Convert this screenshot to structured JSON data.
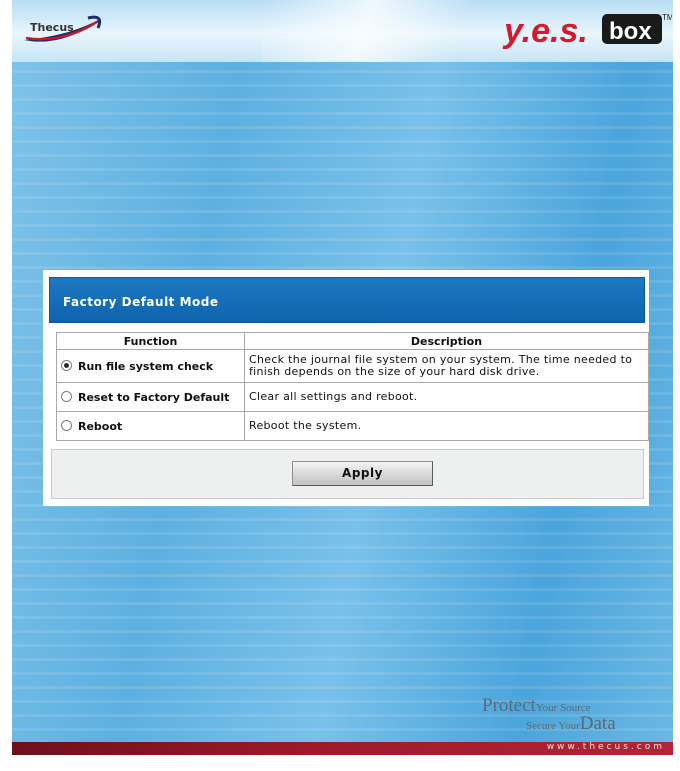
{
  "header": {
    "brand_left": "Thecus",
    "brand_right": "Y.E.S.box",
    "brand_right_box": "box",
    "trademark": "TM"
  },
  "panel": {
    "title": "Factory Default Mode",
    "table": {
      "columns": [
        "Function",
        "Description"
      ],
      "rows": [
        {
          "function": "Run file system check",
          "description": "Check the journal file system on your system. The time needed to finish depends on the size of your hard disk drive.",
          "selected": true
        },
        {
          "function": "Reset to Factory Default",
          "description": "Clear all settings and reboot.",
          "selected": false
        },
        {
          "function": "Reboot",
          "description": "Reboot the system.",
          "selected": false
        }
      ]
    },
    "apply_label": "Apply"
  },
  "slogan": {
    "line1_big": "Protect",
    "line1_small": "Your Source",
    "line2_small": "Secure Your",
    "line2_big": "Data"
  },
  "footer": {
    "url": "www.thecus.com"
  },
  "colors": {
    "title_bar": "#1570b9",
    "footer_bar": "#9d1a28",
    "yes_logo": "#d7192a",
    "box_logo_bg": "#1a1a1a"
  },
  "icons": [
    "thecus-logo-icon",
    "yes-box-logo-icon",
    "radio-checked-icon",
    "radio-unchecked-icon"
  ]
}
